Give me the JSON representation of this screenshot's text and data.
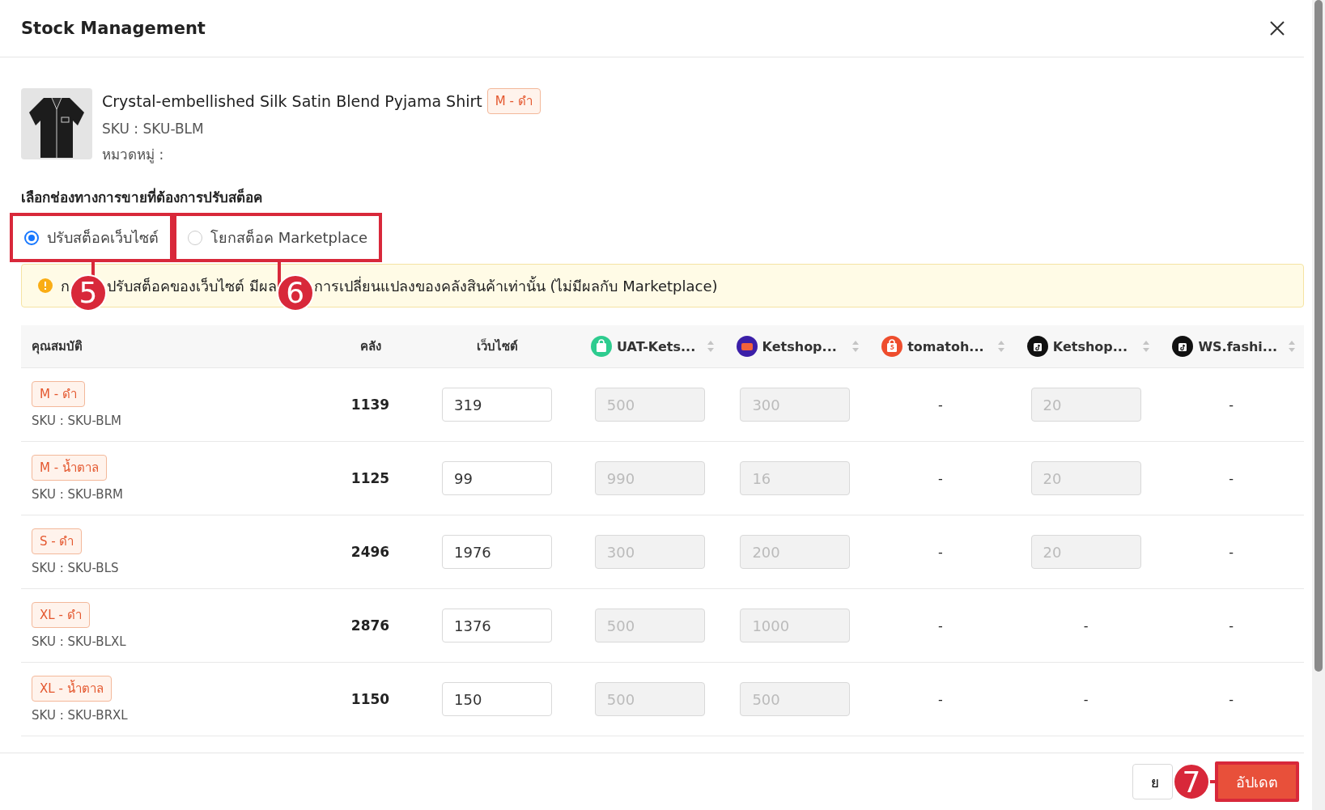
{
  "window": {
    "title": "Stock Management"
  },
  "product": {
    "name": "Crystal-embellished Silk Satin Blend Pyjama Shirt",
    "variant": "M - ดำ",
    "sku": "SKU : SKU-BLM",
    "category": "หมวดหมู่ :"
  },
  "channel_section": {
    "heading": "เลือกช่องทางการขายที่ต้องการปรับสต็อค",
    "options": [
      {
        "label": "ปรับสต็อคเว็บไซต์",
        "selected": true,
        "marked": true,
        "callout": "5"
      },
      {
        "label": "โยกสต็อค Marketplace",
        "selected": false,
        "marked": true,
        "callout": "6"
      }
    ]
  },
  "notice": {
    "parts": [
      "ก",
      "ปรับสต็อคของเว็บไซต์ มีผล",
      "การเปลี่ยนแปลงของคลังสินค้าเท่านั้น (ไม่มีผลกับ Marketplace)"
    ]
  },
  "table": {
    "columns": [
      "คุณสมบัติ",
      "คลัง",
      "เว็บไซต์"
    ],
    "channels": [
      {
        "name": "UAT-Kets...",
        "kind": "bag"
      },
      {
        "name": "Ketshop...",
        "kind": "laz"
      },
      {
        "name": "tomatoh...",
        "kind": "shopee"
      },
      {
        "name": "Ketshop...",
        "kind": "tiktok"
      },
      {
        "name": "WS.fashi...",
        "kind": "tiktok"
      }
    ],
    "rows": [
      {
        "variant": "M - ดำ",
        "sku": "SKU : SKU-BLM",
        "warehouse": "1139",
        "website": "319",
        "channels": [
          "500",
          "300",
          "-",
          "20",
          "-"
        ]
      },
      {
        "variant": "M - น้ำตาล",
        "sku": "SKU : SKU-BRM",
        "warehouse": "1125",
        "website": "99",
        "channels": [
          "990",
          "16",
          "-",
          "20",
          "-"
        ]
      },
      {
        "variant": "S - ดำ",
        "sku": "SKU : SKU-BLS",
        "warehouse": "2496",
        "website": "1976",
        "channels": [
          "300",
          "200",
          "-",
          "20",
          "-"
        ]
      },
      {
        "variant": "XL - ดำ",
        "sku": "SKU : SKU-BLXL",
        "warehouse": "2876",
        "website": "1376",
        "channels": [
          "500",
          "1000",
          "-",
          "-",
          "-"
        ]
      },
      {
        "variant": "XL - น้ำตาล",
        "sku": "SKU : SKU-BRXL",
        "warehouse": "1150",
        "website": "150",
        "channels": [
          "500",
          "500",
          "-",
          "-",
          "-"
        ]
      }
    ]
  },
  "footer": {
    "cancel": "ย",
    "update": "อัปเดต",
    "callout": "7"
  }
}
